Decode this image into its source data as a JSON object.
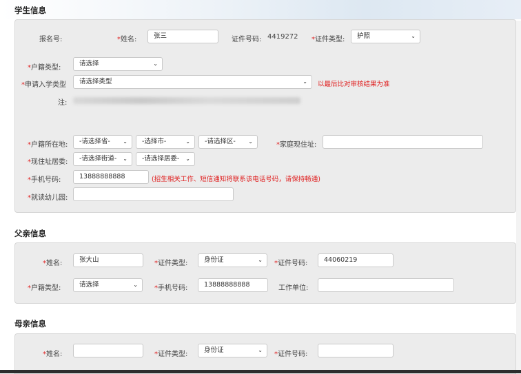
{
  "student": {
    "title": "学生信息",
    "reg_no_label": "报名号:",
    "name_label": "姓名:",
    "name_value": "张三",
    "id_no_label": "证件号码:",
    "id_no_value": "4419272",
    "id_type_label": "证件类型:",
    "id_type_value": "护照",
    "hukou_type_label": "户籍类型:",
    "hukou_type_value": "请选择",
    "apply_type_label": "申请入学类型",
    "apply_type_value": "请选择类型",
    "apply_hint": "以最后比对审核结果为准",
    "note_label": "注:",
    "hukou_loc_label": "户籍所在地:",
    "province_value": "-请选择省-",
    "city_value": "-选择市-",
    "district_value": "-请选择区-",
    "home_addr_label": "家庭现住址:",
    "residence_label": "现住址居委:",
    "street_value": "-请选择街道-",
    "committee_value": "-请选择居委-",
    "phone_label": "手机号码:",
    "phone_value": "13888888888",
    "phone_hint": "(招生相关工作、短信通知将联系该电话号码，请保持畅通)",
    "kindergarten_label": "就读幼儿园:"
  },
  "father": {
    "title": "父亲信息",
    "name_label": "姓名:",
    "name_value": "张大山",
    "id_type_label": "证件类型:",
    "id_type_value": "身份证",
    "id_no_label": "证件号码:",
    "id_no_value": "44060219",
    "hukou_type_label": "户籍类型:",
    "hukou_type_value": "请选择",
    "phone_label": "手机号码:",
    "phone_value": "13888888888",
    "work_label": "工作单位:"
  },
  "mother": {
    "title": "母亲信息",
    "name_label": "姓名:",
    "id_type_label": "证件类型:",
    "id_type_value": "身份证",
    "id_no_label": "证件号码:"
  },
  "colors": {
    "required": "#e02020",
    "panel": "#ececec"
  },
  "icons": {
    "dropdown": "chevron-down-icon"
  }
}
